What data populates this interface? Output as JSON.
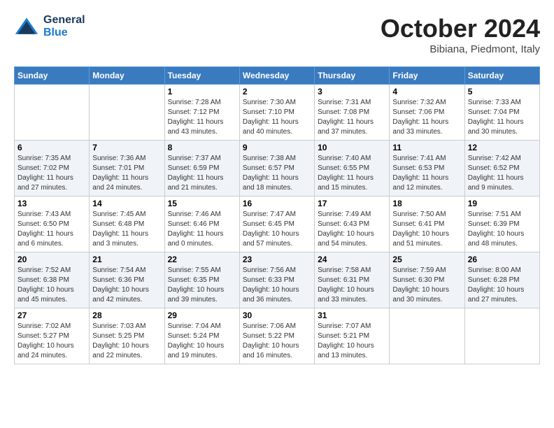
{
  "header": {
    "logo_general": "General",
    "logo_blue": "Blue",
    "month": "October 2024",
    "location": "Bibiana, Piedmont, Italy"
  },
  "days_of_week": [
    "Sunday",
    "Monday",
    "Tuesday",
    "Wednesday",
    "Thursday",
    "Friday",
    "Saturday"
  ],
  "weeks": [
    [
      {
        "num": "",
        "sunrise": "",
        "sunset": "",
        "daylight": ""
      },
      {
        "num": "",
        "sunrise": "",
        "sunset": "",
        "daylight": ""
      },
      {
        "num": "1",
        "sunrise": "Sunrise: 7:28 AM",
        "sunset": "Sunset: 7:12 PM",
        "daylight": "Daylight: 11 hours and 43 minutes."
      },
      {
        "num": "2",
        "sunrise": "Sunrise: 7:30 AM",
        "sunset": "Sunset: 7:10 PM",
        "daylight": "Daylight: 11 hours and 40 minutes."
      },
      {
        "num": "3",
        "sunrise": "Sunrise: 7:31 AM",
        "sunset": "Sunset: 7:08 PM",
        "daylight": "Daylight: 11 hours and 37 minutes."
      },
      {
        "num": "4",
        "sunrise": "Sunrise: 7:32 AM",
        "sunset": "Sunset: 7:06 PM",
        "daylight": "Daylight: 11 hours and 33 minutes."
      },
      {
        "num": "5",
        "sunrise": "Sunrise: 7:33 AM",
        "sunset": "Sunset: 7:04 PM",
        "daylight": "Daylight: 11 hours and 30 minutes."
      }
    ],
    [
      {
        "num": "6",
        "sunrise": "Sunrise: 7:35 AM",
        "sunset": "Sunset: 7:02 PM",
        "daylight": "Daylight: 11 hours and 27 minutes."
      },
      {
        "num": "7",
        "sunrise": "Sunrise: 7:36 AM",
        "sunset": "Sunset: 7:01 PM",
        "daylight": "Daylight: 11 hours and 24 minutes."
      },
      {
        "num": "8",
        "sunrise": "Sunrise: 7:37 AM",
        "sunset": "Sunset: 6:59 PM",
        "daylight": "Daylight: 11 hours and 21 minutes."
      },
      {
        "num": "9",
        "sunrise": "Sunrise: 7:38 AM",
        "sunset": "Sunset: 6:57 PM",
        "daylight": "Daylight: 11 hours and 18 minutes."
      },
      {
        "num": "10",
        "sunrise": "Sunrise: 7:40 AM",
        "sunset": "Sunset: 6:55 PM",
        "daylight": "Daylight: 11 hours and 15 minutes."
      },
      {
        "num": "11",
        "sunrise": "Sunrise: 7:41 AM",
        "sunset": "Sunset: 6:53 PM",
        "daylight": "Daylight: 11 hours and 12 minutes."
      },
      {
        "num": "12",
        "sunrise": "Sunrise: 7:42 AM",
        "sunset": "Sunset: 6:52 PM",
        "daylight": "Daylight: 11 hours and 9 minutes."
      }
    ],
    [
      {
        "num": "13",
        "sunrise": "Sunrise: 7:43 AM",
        "sunset": "Sunset: 6:50 PM",
        "daylight": "Daylight: 11 hours and 6 minutes."
      },
      {
        "num": "14",
        "sunrise": "Sunrise: 7:45 AM",
        "sunset": "Sunset: 6:48 PM",
        "daylight": "Daylight: 11 hours and 3 minutes."
      },
      {
        "num": "15",
        "sunrise": "Sunrise: 7:46 AM",
        "sunset": "Sunset: 6:46 PM",
        "daylight": "Daylight: 11 hours and 0 minutes."
      },
      {
        "num": "16",
        "sunrise": "Sunrise: 7:47 AM",
        "sunset": "Sunset: 6:45 PM",
        "daylight": "Daylight: 10 hours and 57 minutes."
      },
      {
        "num": "17",
        "sunrise": "Sunrise: 7:49 AM",
        "sunset": "Sunset: 6:43 PM",
        "daylight": "Daylight: 10 hours and 54 minutes."
      },
      {
        "num": "18",
        "sunrise": "Sunrise: 7:50 AM",
        "sunset": "Sunset: 6:41 PM",
        "daylight": "Daylight: 10 hours and 51 minutes."
      },
      {
        "num": "19",
        "sunrise": "Sunrise: 7:51 AM",
        "sunset": "Sunset: 6:39 PM",
        "daylight": "Daylight: 10 hours and 48 minutes."
      }
    ],
    [
      {
        "num": "20",
        "sunrise": "Sunrise: 7:52 AM",
        "sunset": "Sunset: 6:38 PM",
        "daylight": "Daylight: 10 hours and 45 minutes."
      },
      {
        "num": "21",
        "sunrise": "Sunrise: 7:54 AM",
        "sunset": "Sunset: 6:36 PM",
        "daylight": "Daylight: 10 hours and 42 minutes."
      },
      {
        "num": "22",
        "sunrise": "Sunrise: 7:55 AM",
        "sunset": "Sunset: 6:35 PM",
        "daylight": "Daylight: 10 hours and 39 minutes."
      },
      {
        "num": "23",
        "sunrise": "Sunrise: 7:56 AM",
        "sunset": "Sunset: 6:33 PM",
        "daylight": "Daylight: 10 hours and 36 minutes."
      },
      {
        "num": "24",
        "sunrise": "Sunrise: 7:58 AM",
        "sunset": "Sunset: 6:31 PM",
        "daylight": "Daylight: 10 hours and 33 minutes."
      },
      {
        "num": "25",
        "sunrise": "Sunrise: 7:59 AM",
        "sunset": "Sunset: 6:30 PM",
        "daylight": "Daylight: 10 hours and 30 minutes."
      },
      {
        "num": "26",
        "sunrise": "Sunrise: 8:00 AM",
        "sunset": "Sunset: 6:28 PM",
        "daylight": "Daylight: 10 hours and 27 minutes."
      }
    ],
    [
      {
        "num": "27",
        "sunrise": "Sunrise: 7:02 AM",
        "sunset": "Sunset: 5:27 PM",
        "daylight": "Daylight: 10 hours and 24 minutes."
      },
      {
        "num": "28",
        "sunrise": "Sunrise: 7:03 AM",
        "sunset": "Sunset: 5:25 PM",
        "daylight": "Daylight: 10 hours and 22 minutes."
      },
      {
        "num": "29",
        "sunrise": "Sunrise: 7:04 AM",
        "sunset": "Sunset: 5:24 PM",
        "daylight": "Daylight: 10 hours and 19 minutes."
      },
      {
        "num": "30",
        "sunrise": "Sunrise: 7:06 AM",
        "sunset": "Sunset: 5:22 PM",
        "daylight": "Daylight: 10 hours and 16 minutes."
      },
      {
        "num": "31",
        "sunrise": "Sunrise: 7:07 AM",
        "sunset": "Sunset: 5:21 PM",
        "daylight": "Daylight: 10 hours and 13 minutes."
      },
      {
        "num": "",
        "sunrise": "",
        "sunset": "",
        "daylight": ""
      },
      {
        "num": "",
        "sunrise": "",
        "sunset": "",
        "daylight": ""
      }
    ]
  ]
}
